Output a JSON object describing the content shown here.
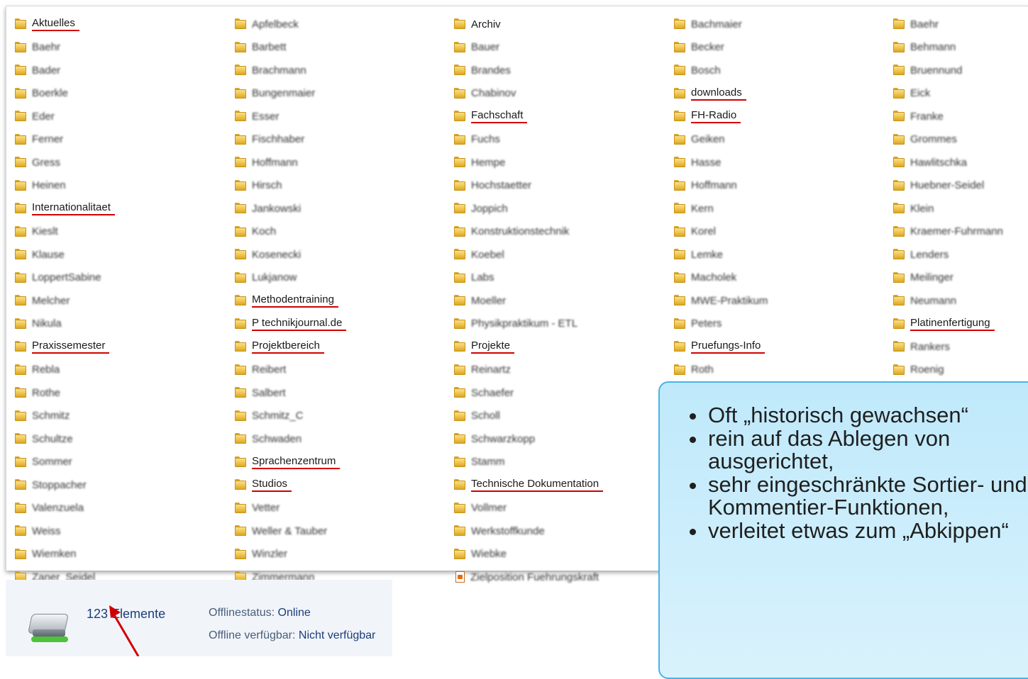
{
  "columns": [
    [
      {
        "name": "Aktuelles",
        "marked": true,
        "blurred": false
      },
      {
        "name": "Baehr",
        "marked": false,
        "blurred": true
      },
      {
        "name": "Bader",
        "marked": false,
        "blurred": true
      },
      {
        "name": "Boerkle",
        "marked": false,
        "blurred": true
      },
      {
        "name": "Eder",
        "marked": false,
        "blurred": true
      },
      {
        "name": "Ferner",
        "marked": false,
        "blurred": true
      },
      {
        "name": "Gress",
        "marked": false,
        "blurred": true
      },
      {
        "name": "Heinen",
        "marked": false,
        "blurred": true
      },
      {
        "name": "Internationalitaet",
        "marked": true,
        "blurred": false
      },
      {
        "name": "Kieslt",
        "marked": false,
        "blurred": true
      },
      {
        "name": "Klause",
        "marked": false,
        "blurred": true
      },
      {
        "name": "LoppertSabine",
        "marked": false,
        "blurred": true
      },
      {
        "name": "Melcher",
        "marked": false,
        "blurred": true
      },
      {
        "name": "Nikula",
        "marked": false,
        "blurred": true
      },
      {
        "name": "Praxissemester",
        "marked": true,
        "blurred": false
      },
      {
        "name": "Rebla",
        "marked": false,
        "blurred": true
      },
      {
        "name": "Rothe",
        "marked": false,
        "blurred": true
      },
      {
        "name": "Schmitz",
        "marked": false,
        "blurred": true
      },
      {
        "name": "Schultze",
        "marked": false,
        "blurred": true
      },
      {
        "name": "Sommer",
        "marked": false,
        "blurred": true
      },
      {
        "name": "Stoppacher",
        "marked": false,
        "blurred": true
      },
      {
        "name": "Valenzuela",
        "marked": false,
        "blurred": true
      },
      {
        "name": "Weiss",
        "marked": false,
        "blurred": true
      },
      {
        "name": "Wiemken",
        "marked": false,
        "blurred": true
      },
      {
        "name": "Zaner_Seidel",
        "marked": false,
        "blurred": true
      }
    ],
    [
      {
        "name": "Apfelbeck",
        "marked": false,
        "blurred": true
      },
      {
        "name": "Barbett",
        "marked": false,
        "blurred": true
      },
      {
        "name": "Brachmann",
        "marked": false,
        "blurred": true
      },
      {
        "name": "Bungenmaier",
        "marked": false,
        "blurred": true
      },
      {
        "name": "Esser",
        "marked": false,
        "blurred": true
      },
      {
        "name": "Fischhaber",
        "marked": false,
        "blurred": true
      },
      {
        "name": "Hoffmann",
        "marked": false,
        "blurred": true
      },
      {
        "name": "Hirsch",
        "marked": false,
        "blurred": true
      },
      {
        "name": "Jankowski",
        "marked": false,
        "blurred": true
      },
      {
        "name": "Koch",
        "marked": false,
        "blurred": true
      },
      {
        "name": "Kosenecki",
        "marked": false,
        "blurred": true
      },
      {
        "name": "Lukjanow",
        "marked": false,
        "blurred": true
      },
      {
        "name": "Methodentraining",
        "marked": true,
        "blurred": false
      },
      {
        "name": "P technikjournal.de",
        "marked": true,
        "blurred": false
      },
      {
        "name": "Projektbereich",
        "marked": true,
        "blurred": false
      },
      {
        "name": "Reibert",
        "marked": false,
        "blurred": true
      },
      {
        "name": "Salbert",
        "marked": false,
        "blurred": true
      },
      {
        "name": "Schmitz_C",
        "marked": false,
        "blurred": true
      },
      {
        "name": "Schwaden",
        "marked": false,
        "blurred": true
      },
      {
        "name": "Sprachenzentrum",
        "marked": true,
        "blurred": false
      },
      {
        "name": "Studios",
        "marked": true,
        "blurred": false
      },
      {
        "name": "Vetter",
        "marked": false,
        "blurred": true
      },
      {
        "name": "Weller & Tauber",
        "marked": false,
        "blurred": true
      },
      {
        "name": "Winzler",
        "marked": false,
        "blurred": true
      },
      {
        "name": "Zimmermann",
        "marked": false,
        "blurred": true
      }
    ],
    [
      {
        "name": "Archiv",
        "marked": false,
        "blurred": false
      },
      {
        "name": "Bauer",
        "marked": false,
        "blurred": true
      },
      {
        "name": "Brandes",
        "marked": false,
        "blurred": true
      },
      {
        "name": "Chabinov",
        "marked": false,
        "blurred": true
      },
      {
        "name": "Fachschaft",
        "marked": true,
        "blurred": false
      },
      {
        "name": "Fuchs",
        "marked": false,
        "blurred": true
      },
      {
        "name": "Hempe",
        "marked": false,
        "blurred": true
      },
      {
        "name": "Hochstaetter",
        "marked": false,
        "blurred": true
      },
      {
        "name": "Joppich",
        "marked": false,
        "blurred": true
      },
      {
        "name": "Konstruktionstechnik",
        "marked": false,
        "blurred": true
      },
      {
        "name": "Koebel",
        "marked": false,
        "blurred": true
      },
      {
        "name": "Labs",
        "marked": false,
        "blurred": true
      },
      {
        "name": "Moeller",
        "marked": false,
        "blurred": true
      },
      {
        "name": "Physikpraktikum - ETL",
        "marked": false,
        "blurred": true
      },
      {
        "name": "Projekte",
        "marked": true,
        "blurred": false
      },
      {
        "name": "Reinartz",
        "marked": false,
        "blurred": true
      },
      {
        "name": "Schaefer",
        "marked": false,
        "blurred": true
      },
      {
        "name": "Scholl",
        "marked": false,
        "blurred": true
      },
      {
        "name": "Schwarzkopp",
        "marked": false,
        "blurred": true
      },
      {
        "name": "Stamm",
        "marked": false,
        "blurred": true
      },
      {
        "name": "Technische Dokumentation",
        "marked": true,
        "blurred": false
      },
      {
        "name": "Vollmer",
        "marked": false,
        "blurred": true
      },
      {
        "name": "Werkstoffkunde",
        "marked": false,
        "blurred": true
      },
      {
        "name": "Wiebke",
        "marked": false,
        "blurred": true
      },
      {
        "name": "Zielposition Fuehrungskraft",
        "marked": false,
        "blurred": true,
        "document": true
      }
    ],
    [
      {
        "name": "Bachmaier",
        "marked": false,
        "blurred": true
      },
      {
        "name": "Becker",
        "marked": false,
        "blurred": true
      },
      {
        "name": "Bosch",
        "marked": false,
        "blurred": true
      },
      {
        "name": "downloads",
        "marked": true,
        "blurred": false
      },
      {
        "name": "FH-Radio",
        "marked": true,
        "blurred": false
      },
      {
        "name": "Geiken",
        "marked": false,
        "blurred": true
      },
      {
        "name": "Hasse",
        "marked": false,
        "blurred": true
      },
      {
        "name": "Hoffmann",
        "marked": false,
        "blurred": true
      },
      {
        "name": "Kern",
        "marked": false,
        "blurred": true
      },
      {
        "name": "Korel",
        "marked": false,
        "blurred": true
      },
      {
        "name": "Lemke",
        "marked": false,
        "blurred": true
      },
      {
        "name": "Macholek",
        "marked": false,
        "blurred": true
      },
      {
        "name": "MWE-Praktikum",
        "marked": false,
        "blurred": true
      },
      {
        "name": "Peters",
        "marked": false,
        "blurred": true
      },
      {
        "name": "Pruefungs-Info",
        "marked": true,
        "blurred": false
      },
      {
        "name": "Roth",
        "marked": false,
        "blurred": true
      }
    ],
    [
      {
        "name": "Baehr",
        "marked": false,
        "blurred": true
      },
      {
        "name": "Behmann",
        "marked": false,
        "blurred": true
      },
      {
        "name": "Bruennund",
        "marked": false,
        "blurred": true
      },
      {
        "name": "Eick",
        "marked": false,
        "blurred": true
      },
      {
        "name": "Franke",
        "marked": false,
        "blurred": true
      },
      {
        "name": "Grommes",
        "marked": false,
        "blurred": true
      },
      {
        "name": "Hawlitschka",
        "marked": false,
        "blurred": true
      },
      {
        "name": "Huebner-Seidel",
        "marked": false,
        "blurred": true
      },
      {
        "name": "Klein",
        "marked": false,
        "blurred": true
      },
      {
        "name": "Kraemer-Fuhrmann",
        "marked": false,
        "blurred": true
      },
      {
        "name": "Lenders",
        "marked": false,
        "blurred": true
      },
      {
        "name": "Meilinger",
        "marked": false,
        "blurred": true
      },
      {
        "name": "Neumann",
        "marked": false,
        "blurred": true
      },
      {
        "name": "Platinenfertigung",
        "marked": true,
        "blurred": false
      },
      {
        "name": "Rankers",
        "marked": false,
        "blurred": true
      },
      {
        "name": "Roenig",
        "marked": false,
        "blurred": true
      }
    ]
  ],
  "status_bar": {
    "count": "123 Elemente",
    "offline_status_label": "Offlinestatus:",
    "offline_status_value": "Online",
    "offline_available_label": "Offline verfügbar:",
    "offline_available_value": "Nicht verfügbar"
  },
  "callout": {
    "bullets": [
      "Oft „historisch gewachsen“",
      "rein auf das Ablegen von",
      "ausgerichtet,",
      "sehr eingeschränkte Sortier- und",
      "Kommentier-Funktionen,",
      "verleitet etwas zum „Abkippen“"
    ],
    "bullet_flags": [
      true,
      true,
      false,
      true,
      false,
      true
    ]
  },
  "colors": {
    "marker_red": "#d10000",
    "callout_border": "#4ab3e6",
    "callout_fill": "#c9eefb"
  }
}
